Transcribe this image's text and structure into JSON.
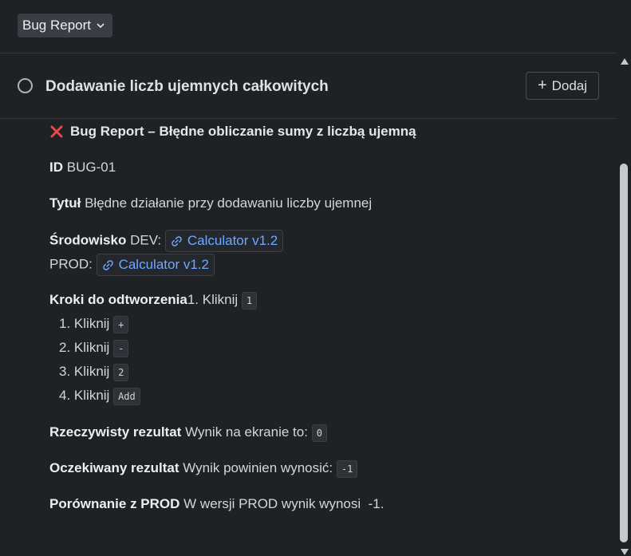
{
  "issue_type": {
    "label": "Bug Report"
  },
  "issue": {
    "title": "Dodawanie liczb ujemnych całkowitych",
    "add_button_label": "Dodaj"
  },
  "report": {
    "heading": "Bug Report – Błędne obliczanie sumy z liczbą ujemną",
    "id_label": "ID",
    "id_value": "BUG-01",
    "title_label": "Tytuł",
    "title_value": "Błędne działanie przy dodawaniu liczby ujemnej",
    "env_label": "Środowisko",
    "env_dev_prefix": "DEV:",
    "env_dev_link": "Calculator v1.2",
    "env_prod_prefix": "PROD:",
    "env_prod_link": "Calculator v1.2",
    "steps_label": "Kroki do odtworzenia",
    "steps_first": "1. Kliknij",
    "steps_first_code": "1",
    "steps": [
      {
        "num": "1.",
        "text": "Kliknij",
        "code": "+"
      },
      {
        "num": "2.",
        "text": "Kliknij",
        "code": "-"
      },
      {
        "num": "3.",
        "text": "Kliknij",
        "code": "2"
      },
      {
        "num": "4.",
        "text": "Kliknij",
        "code": "Add"
      }
    ],
    "actual_label": "Rzeczywisty rezultat",
    "actual_text": "Wynik na ekranie to:",
    "actual_code": "0",
    "expected_label": "Oczekiwany rezultat",
    "expected_text": "Wynik powinien wynosić:",
    "expected_code": "-1",
    "compare_label": "Porównanie z PROD",
    "compare_text": "W wersji PROD wynik wynosi  -1."
  },
  "icons": {
    "dropdown": "chevron-down-icon",
    "status": "circle-icon",
    "add": "plus-icon",
    "bug": "red-x-icon",
    "link": "link-icon"
  },
  "colors": {
    "link": "#6ea8ff",
    "error": "#e5484d",
    "background": "#1f2124"
  }
}
